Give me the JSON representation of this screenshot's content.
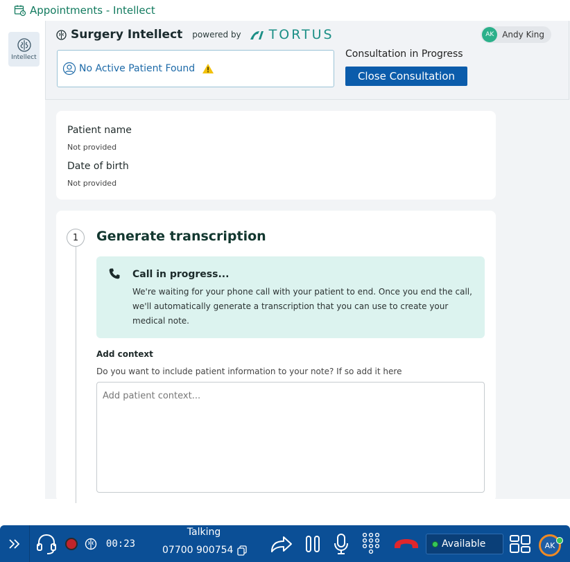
{
  "window": {
    "title": "Appointments - Intellect"
  },
  "rail": {
    "intellect_label": "Intellect"
  },
  "header": {
    "brand": "Surgery Intellect",
    "powered_by": "powered by",
    "partner": "TORTUS",
    "user_initials": "AK",
    "user_name": "Andy King",
    "patient_status": "No Active Patient Found",
    "consultation_status": "Consultation in Progress",
    "close_label": "Close Consultation"
  },
  "patient": {
    "name_label": "Patient name",
    "name_value": "Not provided",
    "dob_label": "Date of birth",
    "dob_value": "Not provided"
  },
  "step": {
    "number": "1",
    "title": "Generate transcription",
    "call_title": "Call in progress...",
    "call_text": "We're waiting for your phone call with your patient to end. Once you end the call, we'll automatically generate a transcription that you can use to create your medical note.",
    "context_label": "Add context",
    "context_help": "Do you want to include patient information to your note? If so add it here",
    "context_placeholder": "Add patient context..."
  },
  "callbar": {
    "timer": "00:23",
    "status": "Talking",
    "phone": "07700 900754",
    "availability": "Available",
    "initials": "AK"
  },
  "colors": {
    "accent": "#117a5e",
    "primary_button": "#0b5cab",
    "callbar": "#0b4f96",
    "hangup": "#e0262c"
  }
}
